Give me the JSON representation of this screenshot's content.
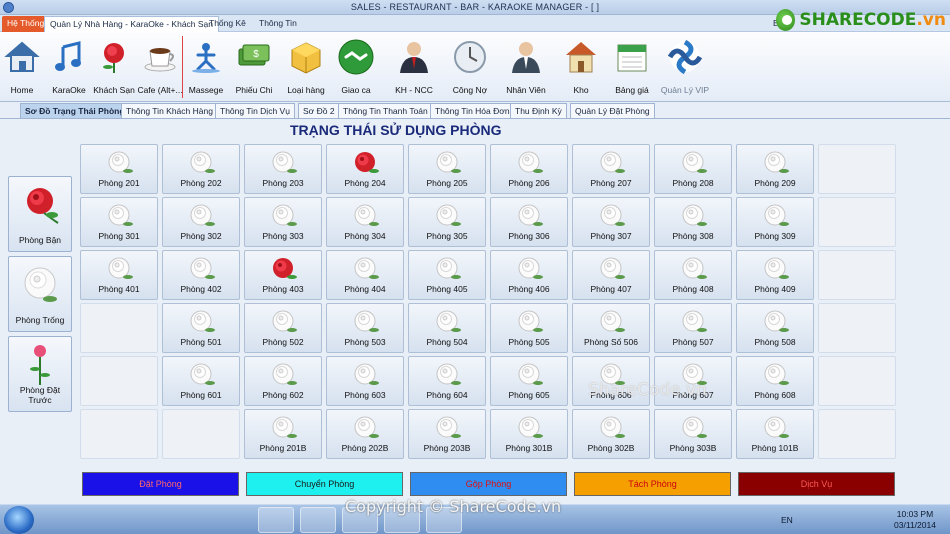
{
  "window": {
    "title": "SALES - RESTAURANT - BAR - KARAOKE MANAGER - [          ]"
  },
  "brand": {
    "logo_text_main": "SHARECODE",
    "logo_text_suffix": ".vn"
  },
  "menu_tabs": [
    {
      "label": "Hệ Thống"
    },
    {
      "label": "Quản Lý Nhà Hàng - KaraOke - Khách Sạn"
    },
    {
      "label": "Thống Kê"
    },
    {
      "label": "Thông Tin"
    },
    {
      "label": "Ban"
    }
  ],
  "ribbon": [
    {
      "label": "Home",
      "icon": "home-icon"
    },
    {
      "label": "KaraOke",
      "icon": "music-note-icon"
    },
    {
      "label": "Khách Sạn",
      "icon": "rose-icon"
    },
    {
      "label": "Cafe (Alt+...",
      "icon": "coffee-cup-icon"
    },
    {
      "label": "Massege",
      "icon": "massage-icon"
    },
    {
      "label": "Phiếu Chi",
      "icon": "money-icon"
    },
    {
      "label": "Loại hàng",
      "icon": "box-icon"
    },
    {
      "label": "Giao ca",
      "icon": "handshake-icon"
    },
    {
      "label": "KH - NCC",
      "icon": "customer-icon"
    },
    {
      "label": "Công Nợ",
      "icon": "clock-icon"
    },
    {
      "label": "Nhân Viên",
      "icon": "employee-icon"
    },
    {
      "label": "Kho",
      "icon": "warehouse-icon"
    },
    {
      "label": "Bảng giá",
      "icon": "calendar-icon"
    },
    {
      "label": "Quản Lý VIP",
      "icon": "vip-icon"
    }
  ],
  "sub_tabs": [
    {
      "label": "Sơ Đồ Trạng Thái Phòng"
    },
    {
      "label": "Thông Tin Khách Hàng"
    },
    {
      "label": "Thông Tin Dịch Vụ"
    },
    {
      "label": "Sơ Đồ 2"
    },
    {
      "label": "Thông Tin Thanh Toán"
    },
    {
      "label": "Thông Tin Hóa Đơn"
    },
    {
      "label": "Thu Định Kỳ"
    },
    {
      "label": "Quản Lý Đặt Phòng"
    }
  ],
  "page_title": "TRẠNG THÁI SỬ DỤNG PHÒNG",
  "legend": [
    {
      "label": "Phòng Bận",
      "icon": "red-rose-icon"
    },
    {
      "label": "Phòng Trống",
      "icon": "white-rose-icon"
    },
    {
      "label": "Phòng Đặt Trước",
      "icon": "pink-rose-icon"
    }
  ],
  "rooms": [
    [
      {
        "label": "Phòng 201",
        "status": "free"
      },
      {
        "label": "Phòng 202",
        "status": "free"
      },
      {
        "label": "Phòng 203",
        "status": "free"
      },
      {
        "label": "Phòng 204",
        "status": "busy"
      },
      {
        "label": "Phòng 205",
        "status": "free"
      },
      {
        "label": "Phòng 206",
        "status": "free"
      },
      {
        "label": "Phòng 207",
        "status": "free"
      },
      {
        "label": "Phòng 208",
        "status": "free"
      },
      {
        "label": "Phòng 209",
        "status": "free"
      },
      {
        "label": "",
        "status": "empty"
      }
    ],
    [
      {
        "label": "Phòng 301",
        "status": "free"
      },
      {
        "label": "Phòng 302",
        "status": "free"
      },
      {
        "label": "Phòng 303",
        "status": "free"
      },
      {
        "label": "Phòng 304",
        "status": "free"
      },
      {
        "label": "Phòng 305",
        "status": "free"
      },
      {
        "label": "Phòng 306",
        "status": "free"
      },
      {
        "label": "Phòng 307",
        "status": "free"
      },
      {
        "label": "Phòng 308",
        "status": "free"
      },
      {
        "label": "Phòng 309",
        "status": "free"
      },
      {
        "label": "",
        "status": "empty"
      }
    ],
    [
      {
        "label": "Phòng 401",
        "status": "free"
      },
      {
        "label": "Phòng 402",
        "status": "free"
      },
      {
        "label": "Phòng 403",
        "status": "busy"
      },
      {
        "label": "Phòng 404",
        "status": "free"
      },
      {
        "label": "Phòng 405",
        "status": "free"
      },
      {
        "label": "Phòng 406",
        "status": "free"
      },
      {
        "label": "Phòng 407",
        "status": "free"
      },
      {
        "label": "Phòng 408",
        "status": "free"
      },
      {
        "label": "Phòng 409",
        "status": "free"
      },
      {
        "label": "",
        "status": "empty"
      }
    ],
    [
      {
        "label": "",
        "status": "empty"
      },
      {
        "label": "Phòng 501",
        "status": "free"
      },
      {
        "label": "Phòng 502",
        "status": "free"
      },
      {
        "label": "Phòng 503",
        "status": "free"
      },
      {
        "label": "Phòng 504",
        "status": "free"
      },
      {
        "label": "Phòng 505",
        "status": "free"
      },
      {
        "label": "Phòng Số 506",
        "status": "free"
      },
      {
        "label": "Phòng 507",
        "status": "free"
      },
      {
        "label": "Phòng 508",
        "status": "free"
      },
      {
        "label": "",
        "status": "empty"
      }
    ],
    [
      {
        "label": "",
        "status": "empty"
      },
      {
        "label": "Phòng 601",
        "status": "free"
      },
      {
        "label": "Phòng 602",
        "status": "free"
      },
      {
        "label": "Phòng 603",
        "status": "free"
      },
      {
        "label": "Phòng 604",
        "status": "free"
      },
      {
        "label": "Phòng 605",
        "status": "free"
      },
      {
        "label": "Phòng 606",
        "status": "free"
      },
      {
        "label": "Phòng 607",
        "status": "free"
      },
      {
        "label": "Phòng 608",
        "status": "free"
      },
      {
        "label": "",
        "status": "empty"
      }
    ],
    [
      {
        "label": "",
        "status": "empty"
      },
      {
        "label": "",
        "status": "empty"
      },
      {
        "label": "Phòng 201B",
        "status": "free"
      },
      {
        "label": "Phòng 202B",
        "status": "free"
      },
      {
        "label": "Phòng 203B",
        "status": "free"
      },
      {
        "label": "Phòng 301B",
        "status": "free"
      },
      {
        "label": "Phòng 302B",
        "status": "free"
      },
      {
        "label": "Phòng 303B",
        "status": "free"
      },
      {
        "label": "Phòng 101B",
        "status": "free"
      },
      {
        "label": "",
        "status": "empty"
      }
    ]
  ],
  "actions": [
    {
      "label": "Đặt Phòng",
      "bg": "#1a10e8",
      "fg": "#ff6a6a"
    },
    {
      "label": "Chuyển Phòng",
      "bg": "#1ef0f0",
      "fg": "#1a1a1a"
    },
    {
      "label": "Gộp Phòng",
      "bg": "#2f8cf0",
      "fg": "#d11"
    },
    {
      "label": "Tách Phòng",
      "bg": "#f5a000",
      "fg": "#c01"
    },
    {
      "label": "Dịch Vụ",
      "bg": "#8a0000",
      "fg": "#ff5a5a"
    }
  ],
  "taskbar": {
    "language": "EN",
    "time": "10:03 PM",
    "date": "03/11/2014"
  },
  "watermarks": {
    "bottom": "Copyright © ShareCode.vn",
    "middle": "ShareCode.vn"
  },
  "colors": {
    "accent": "#1a2a7a",
    "system_tab": "#e55a2a"
  }
}
